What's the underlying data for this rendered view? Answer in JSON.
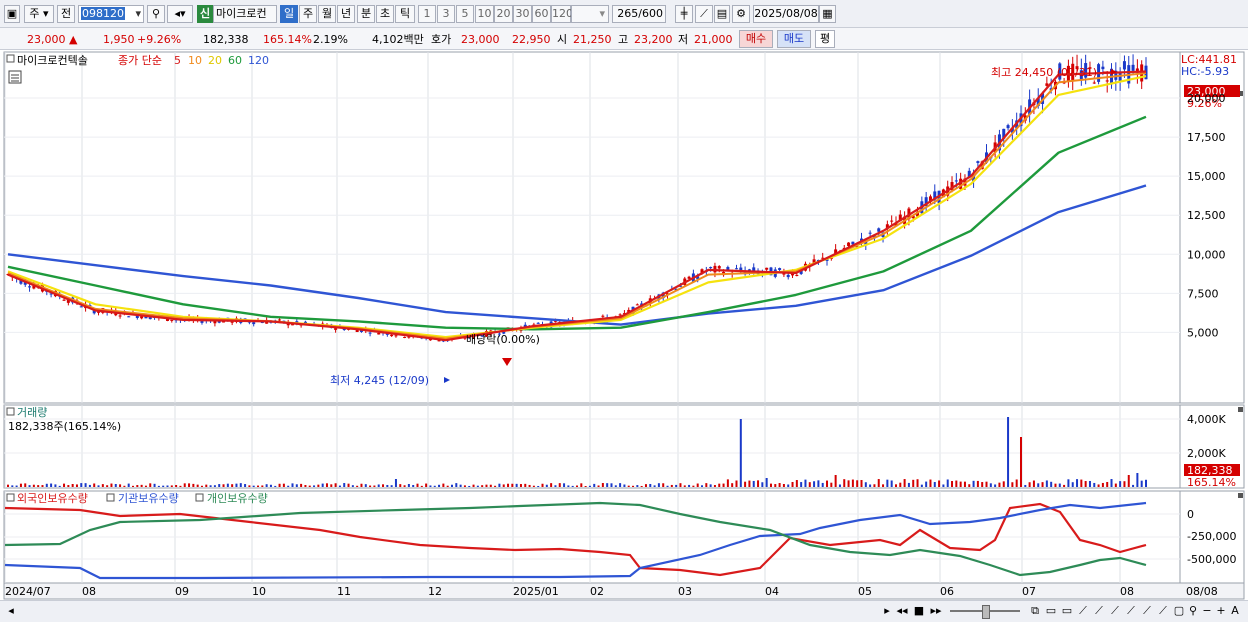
{
  "toolbar": {
    "period_type": "주",
    "jeon": "전",
    "stock_code": "098120",
    "shin": "신",
    "stock_name": "마이크로컨",
    "tabs": [
      "일",
      "주",
      "월",
      "년",
      "분",
      "초",
      "틱"
    ],
    "active_tab": "일",
    "minute_options": [
      "1",
      "3",
      "5",
      "10",
      "20",
      "30",
      "60",
      "120"
    ],
    "count": "265",
    "count_total": "/600",
    "date": "2025/08/08"
  },
  "quote": {
    "price": "23,000",
    "change": "1,950",
    "change_pct": "+9.26%",
    "volume": "182,338",
    "volume_ratio": "165.14%",
    "turnover": "2.19%",
    "amount": "4,102백만",
    "hoga_label": "호가",
    "ask": "23,000",
    "bid": "22,950",
    "open_label": "시",
    "open": "21,250",
    "high_label": "고",
    "high": "23,200",
    "low_label": "저",
    "low": "21,000",
    "buy_label": "매수",
    "sell_label": "매도",
    "eval_label": "평"
  },
  "price_panel": {
    "stock_label": "마이크로컨텍솔",
    "ma_title": "종가 단순",
    "ma_periods": [
      "5",
      "10",
      "20",
      "60",
      "120"
    ],
    "lc": "LC:441.81",
    "hc": "HC:-5.93",
    "last_price_tag": "23,000",
    "last_pct_tag": "9.26%",
    "high_annot": "최고 24,450 (07/31)",
    "low_annot": "최저 4,245 (12/09)",
    "dividend_annot": "배당락(0.00%)",
    "y_ticks": [
      "20,000",
      "17,500",
      "15,000",
      "12,500",
      "10,000",
      "7,500",
      "5,000"
    ]
  },
  "volume_panel": {
    "title": "거래량",
    "summary": "182,338주(165.14%)",
    "y_ticks": [
      "4,000K",
      "2,000K"
    ],
    "last_tag": "182,338",
    "last_pct": "165.14%"
  },
  "holdings_panel": {
    "series_labels": [
      "외국인보유수량",
      "기관보유수량",
      "개인보유수량"
    ],
    "y_ticks": [
      "0",
      "-250,000",
      "-500,000"
    ]
  },
  "x_axis": [
    "2024/07",
    "08",
    "09",
    "10",
    "11",
    "12",
    "2025/01",
    "02",
    "03",
    "04",
    "05",
    "06",
    "07",
    "08",
    "08/08"
  ],
  "colors": {
    "ma5": "#d81b1b",
    "ma10": "#f08a1c",
    "ma20": "#f5e20e",
    "ma60": "#1e9a3c",
    "ma120": "#2f55d4",
    "up": "#d40000",
    "down": "#1a39c9",
    "foreign": "#d81b1b",
    "institution": "#2f55d4",
    "individual": "#2e8b57"
  },
  "chart_data": {
    "type": "line",
    "x": [
      "2024/07",
      "08",
      "09",
      "10",
      "11",
      "12",
      "2025/01",
      "02",
      "03",
      "04",
      "05",
      "06",
      "07",
      "08"
    ],
    "series": [
      {
        "name": "5",
        "values": [
          8700,
          6400,
          5800,
          5700,
          5200,
          4500,
          5400,
          6000,
          9000,
          8800,
          11500,
          15000,
          21500,
          21700
        ]
      },
      {
        "name": "10",
        "values": [
          8800,
          6500,
          5900,
          5700,
          5250,
          4600,
          5350,
          5900,
          8700,
          8900,
          11300,
          14800,
          21000,
          21600
        ]
      },
      {
        "name": "20",
        "values": [
          8900,
          6800,
          6000,
          5700,
          5300,
          4700,
          5300,
          5800,
          8200,
          9000,
          11000,
          14500,
          20200,
          21400
        ]
      },
      {
        "name": "60",
        "values": [
          9200,
          8000,
          6800,
          6000,
          5700,
          5300,
          5200,
          5300,
          6300,
          7400,
          8900,
          11500,
          16500,
          18800
        ]
      },
      {
        "name": "120",
        "values": [
          10000,
          9300,
          8600,
          8000,
          7200,
          6300,
          5900,
          5500,
          6200,
          6700,
          7700,
          9900,
          12700,
          14400
        ]
      }
    ],
    "ylim": [
      4000,
      25000
    ]
  }
}
